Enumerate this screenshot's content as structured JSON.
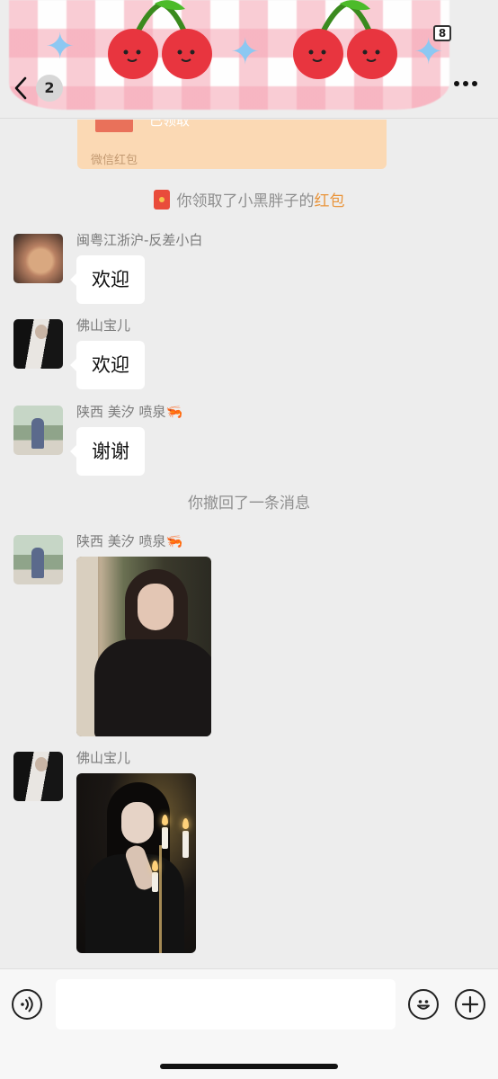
{
  "status_bar": {
    "battery": "8"
  },
  "header": {
    "unread_count": "2",
    "back_icon": "chevron-left-icon",
    "more_icon": "ellipsis-icon"
  },
  "red_packet_card": {
    "status": "已领取",
    "label": "微信红包"
  },
  "system_messages": {
    "received_prefix": "你领取了小黑胖子的",
    "received_highlight": "红包",
    "recalled": "你撤回了一条消息"
  },
  "messages": [
    {
      "sender": "闽粤江浙沪-反差小白",
      "text": "欢迎"
    },
    {
      "sender": "佛山宝儿",
      "text": "欢迎"
    },
    {
      "sender": "陕西 美汐 喷泉",
      "sender_emoji": "🦐",
      "text": "谢谢"
    },
    {
      "sender": "陕西 美汐 喷泉",
      "sender_emoji": "🦐",
      "type": "image"
    },
    {
      "sender": "佛山宝儿",
      "type": "image"
    }
  ],
  "input_bar": {
    "voice_icon": "voice-icon",
    "emoji_icon": "emoji-icon",
    "plus_icon": "plus-icon",
    "input_value": ""
  },
  "colors": {
    "background": "#ededed",
    "bubble": "#ffffff",
    "red_packet": "#fbd9b4",
    "highlight": "#e9943a",
    "system_text": "#8e8e8e"
  }
}
